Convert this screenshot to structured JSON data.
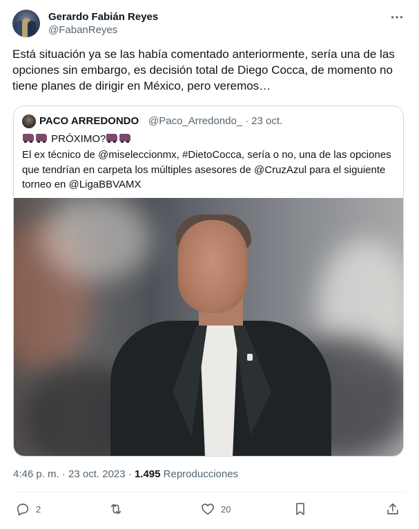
{
  "author": {
    "display_name": "Gerardo Fabián Reyes",
    "handle": "@FabanReyes",
    "more_icon": "more-horizontal-icon"
  },
  "tweet": {
    "text": "Está situación ya se las había comentado anteriormente, sería una de las opciones sin embargo, es decisión total de Diego Cocca, de momento no tiene planes de dirigir en México, pero veremos…"
  },
  "quote": {
    "name": "PACO ARREDONDO",
    "handle": "@Paco_Arredondo_",
    "separator": "·",
    "date": "23 oct.",
    "headline": "PRÓXIMO?",
    "headline_emoji": "locomotive-icon",
    "body": "El ex técnico de @miseleccionmx, #DietoCocca, sería o no, una de las opciones que tendrían en carpeta los múltiples asesores de @CruzAzul para el siguiente torneo en @LigaBBVAMX"
  },
  "meta": {
    "time": "4:46 p. m. · 23 oct. 2023 ·",
    "views_count": "1.495",
    "views_label": "Reproducciones"
  },
  "actions": {
    "reply_count": "2",
    "retweet_count": "",
    "like_count": "20",
    "icons": [
      "reply-icon",
      "retweet-icon",
      "like-icon",
      "bookmark-icon",
      "share-icon"
    ]
  },
  "colors": {
    "text": "#0f1419",
    "secondary": "#536471",
    "border": "#cfd9de"
  }
}
